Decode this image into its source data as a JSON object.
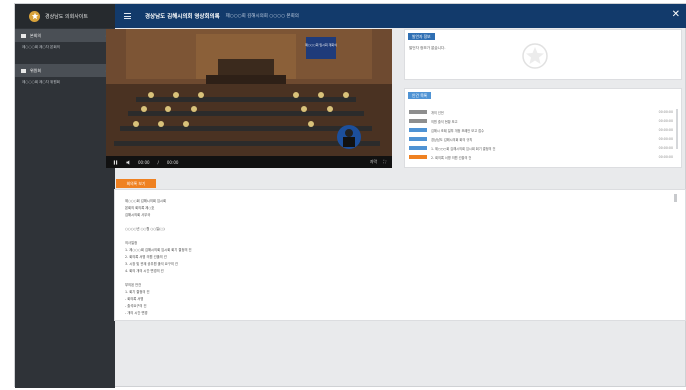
{
  "app": {
    "site_title": "경상남도 의회사이트",
    "header_title": "경상남도 김해시의회 영상회의록",
    "header_subtitle": "제○○○회 김해시의회 ○○○○ 본회의"
  },
  "sidebar": {
    "groups": [
      {
        "label": "본회의",
        "items": [
          "제○○○회 제○차 본회의"
        ]
      },
      {
        "label": "위원회",
        "items": [
          "제○○○회 제○차 위원회"
        ]
      }
    ]
  },
  "video": {
    "caption": "제○○○회 임시회 개회식",
    "time_current": "00:00",
    "time_separator": "/",
    "time_total": "00:00",
    "cc_label": "자막"
  },
  "speaker_panel": {
    "badge": "발언자 정보",
    "text": "발언자 정보가 없습니다."
  },
  "agenda_panel": {
    "badge": "안건 목록",
    "rows": [
      {
        "tag_color": "#8e8e8e",
        "text": "개의 선언",
        "time": "00:00:00"
      },
      {
        "tag_color": "#8e8e8e",
        "text": "의원 출석 현황 보고",
        "time": "00:00:00"
      },
      {
        "tag_color": "#4f93d4",
        "text": "김해시 조례 일부 개정 조례안 보고 접수",
        "time": "00:00:00"
      },
      {
        "tag_color": "#4f93d4",
        "text": "경상남도 김해시의회 회의 규칙",
        "time": "00:00:00"
      },
      {
        "tag_color": "#4f93d4",
        "text": "1. 제○○○회 김해시의회 임시회 회기 결정의 건",
        "time": "00:00:00"
      },
      {
        "tag_color": "#ef8121",
        "text": "2. 회의록 서명 의원 선출의 건",
        "time": "00:00:00"
      }
    ]
  },
  "document": {
    "tab_label": "회의록 보기",
    "lines": [
      "제○○○회 김해시의회 임시회",
      "본회의 회의록 제○호",
      "김해시의회 사무국",
      "",
      "○○○○년 ○○월 ○○일(○)",
      "",
      "의사일정",
      "1. 제○○○회 김해시의회 임시회 회기 결정의 건",
      "2. 회의록 서명 의원 선출의 건",
      "3. 시장 및 관계 공무원 출석 요구의 건",
      "4. 회의 개의 시간 변경의 건",
      "",
      "부의된 안건",
      "1. 회기 결정의 건",
      "- 회의록 서명",
      "- 출석요구의 건",
      "- 개의 시간 변경"
    ]
  },
  "colors": {
    "header": "#123a6b",
    "sidebar": "#2f3338",
    "badge_blue": "#2f6fb3",
    "accent_orange": "#ef8121"
  }
}
